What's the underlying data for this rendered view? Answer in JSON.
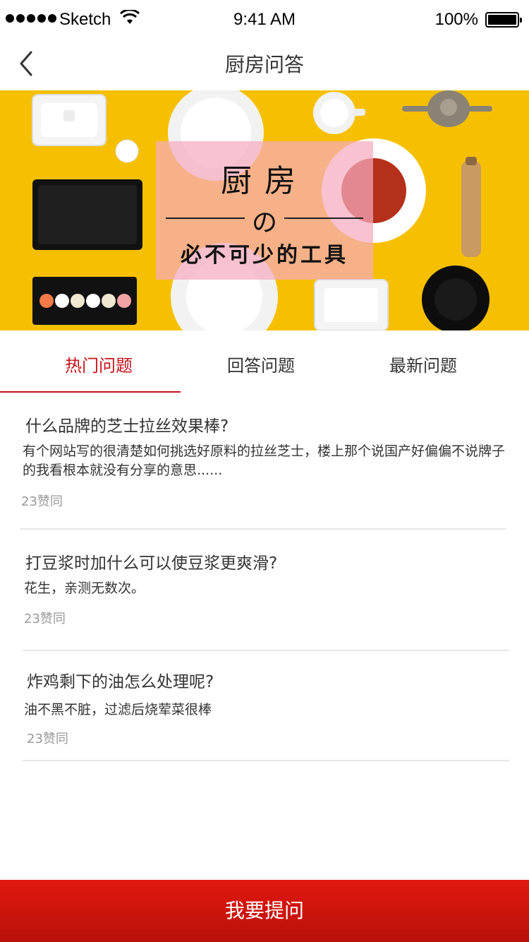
{
  "status_bar": {
    "carrier": "Sketch",
    "time": "9:41 AM",
    "battery": "100%"
  },
  "nav": {
    "title": "厨房问答"
  },
  "banner": {
    "title": "厨房",
    "connector": "の",
    "subtitle": "必不可少的工具"
  },
  "tabs": [
    {
      "label": "热门问题",
      "active": true
    },
    {
      "label": "回答问题",
      "active": false
    },
    {
      "label": "最新问题",
      "active": false
    }
  ],
  "questions": [
    {
      "title": "什么品牌的芝士拉丝效果棒?",
      "body": "有个网站写的很清楚如何挑选好原料的拉丝芝士，楼上那个说国产好偏偏不说牌子的我看根本就没有分享的意思......",
      "likes": "23赞同"
    },
    {
      "title": "打豆浆时加什么可以使豆浆更爽滑?",
      "body": "花生，亲测无数次。",
      "likes": "23赞同"
    },
    {
      "title": "炸鸡剩下的油怎么处理呢?",
      "body": "油不黑不脏，过滤后烧荤菜很棒",
      "likes": "23赞同"
    }
  ],
  "ask_button": {
    "label": "我要提问"
  },
  "colors": {
    "accent": "#c4131a",
    "banner_bg": "#f6c001"
  }
}
